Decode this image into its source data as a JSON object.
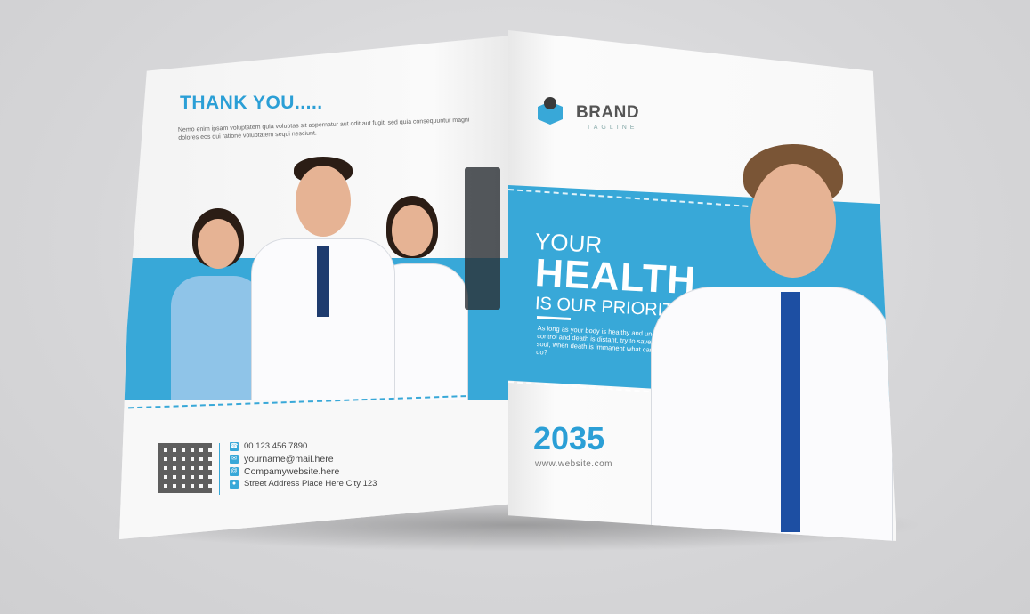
{
  "left_page": {
    "heading": "THANK YOU.....",
    "body_text": "Nemo enim ipsam voluptatem quia voluptas sit aspernatur aut odit aut fugit, sed quia consequuntur magni dolores eos qui ratione voluptatem sequi nesciunt.",
    "contacts": [
      {
        "icon": "phone-icon",
        "glyph": "☎",
        "text": "00 123 456 7890"
      },
      {
        "icon": "mail-icon",
        "glyph": "✉",
        "text": "yourname@mail.here"
      },
      {
        "icon": "web-icon",
        "glyph": "@",
        "text": "Compamywebsite.here"
      },
      {
        "icon": "location-icon",
        "glyph": "●",
        "text": "Street Address Place Here City 123"
      }
    ]
  },
  "right_page": {
    "brand_name": "BRAND",
    "tagline": "TAGLINE",
    "headline_line1": "YOUR",
    "headline_line2": "HEALTH",
    "headline_line3": "IS OUR PRIORITY",
    "description": "As long as your body is healthy and under control and death is distant, try to save your soul, when death is immanent what can you do?",
    "year": "2035",
    "website": "www.website.com"
  },
  "colors": {
    "accent": "#38a8d8",
    "heading_blue": "#2b9fd6",
    "background": "#dcdcde"
  }
}
